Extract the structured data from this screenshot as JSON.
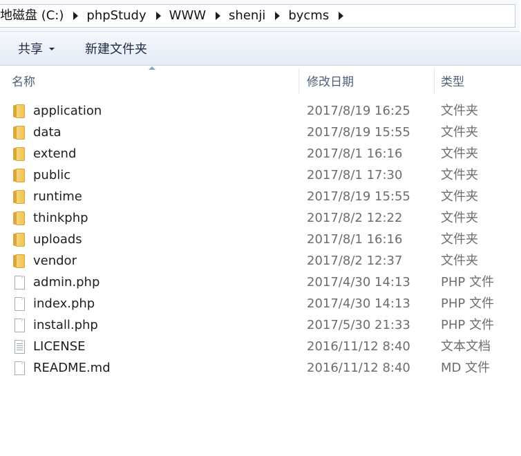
{
  "address": {
    "breadcrumbs": [
      "地磁盘 (C:)",
      "phpStudy",
      "WWW",
      "shenji",
      "bycms"
    ]
  },
  "toolbar": {
    "share_label": "共享",
    "new_folder_label": "新建文件夹"
  },
  "columns": {
    "name": "名称",
    "date": "修改日期",
    "type": "类型"
  },
  "files": [
    {
      "name": "application",
      "date": "2017/8/19 16:25",
      "type": "文件夹",
      "icon": "folder-icon"
    },
    {
      "name": "data",
      "date": "2017/8/19 15:55",
      "type": "文件夹",
      "icon": "folder-icon"
    },
    {
      "name": "extend",
      "date": "2017/8/1 16:16",
      "type": "文件夹",
      "icon": "folder-icon"
    },
    {
      "name": "public",
      "date": "2017/8/1 17:30",
      "type": "文件夹",
      "icon": "folder-icon"
    },
    {
      "name": "runtime",
      "date": "2017/8/19 15:55",
      "type": "文件夹",
      "icon": "folder-icon"
    },
    {
      "name": "thinkphp",
      "date": "2017/8/2 12:22",
      "type": "文件夹",
      "icon": "folder-icon"
    },
    {
      "name": "uploads",
      "date": "2017/8/1 16:16",
      "type": "文件夹",
      "icon": "folder-icon"
    },
    {
      "name": "vendor",
      "date": "2017/8/2 12:37",
      "type": "文件夹",
      "icon": "folder-icon"
    },
    {
      "name": "admin.php",
      "date": "2017/4/30 14:13",
      "type": "PHP 文件",
      "icon": "file-icon"
    },
    {
      "name": "index.php",
      "date": "2017/4/30 14:13",
      "type": "PHP 文件",
      "icon": "file-icon"
    },
    {
      "name": "install.php",
      "date": "2017/5/30 21:33",
      "type": "PHP 文件",
      "icon": "file-icon"
    },
    {
      "name": "LICENSE",
      "date": "2016/11/12 8:40",
      "type": "文本文档",
      "icon": "text-file-icon"
    },
    {
      "name": "README.md",
      "date": "2016/11/12 8:40",
      "type": "MD 文件",
      "icon": "file-icon"
    }
  ]
}
